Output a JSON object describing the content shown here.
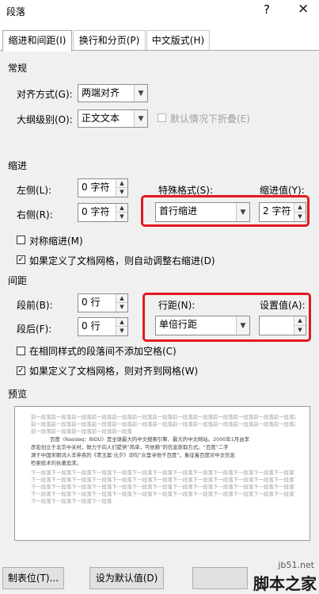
{
  "dialog": {
    "title": "段落",
    "help": "?",
    "close": "×"
  },
  "tabs": [
    {
      "label": "缩进和间距(I)"
    },
    {
      "label": "换行和分页(P)"
    },
    {
      "label": "中文版式(H)"
    }
  ],
  "general": {
    "heading": "常规",
    "alignment_label": "对齐方式(G):",
    "alignment_value": "两端对齐",
    "outline_label": "大纲级别(O):",
    "outline_value": "正文文本",
    "collapse_label": "默认情况下折叠(E)"
  },
  "indent": {
    "heading": "缩进",
    "left_label": "左侧(L):",
    "left_value": "0 字符",
    "right_label": "右侧(R):",
    "right_value": "0 字符",
    "special_label": "特殊格式(S):",
    "special_value": "首行缩进",
    "by_label": "缩进值(Y):",
    "by_value": "2 字符",
    "mirror_label": "对称缩进(M)",
    "auto_adjust_label": "如果定义了文档网格，则自动调整右缩进(D)"
  },
  "spacing": {
    "heading": "间距",
    "before_label": "段前(B):",
    "before_value": "0 行",
    "after_label": "段后(F):",
    "after_value": "0 行",
    "line_label": "行距(N):",
    "line_value": "单倍行距",
    "at_label": "设置值(A):",
    "at_value": "",
    "no_space_label": "在相同样式的段落间不添加空格(C)",
    "snap_grid_label": "如果定义了文档网格，则对齐到网格(W)"
  },
  "preview": {
    "heading": "预览",
    "prev_line": "前一段落前一段落前一段落前一段落前一段落前一段落前一段落前一段落前一段落前一段落前一段落前一段落前一段落前一段落",
    "prev_line_short": "前一段落前一段落前一段落前一段落前一段落",
    "body_lines": [
      "百度（Nasdaq：BIDU）是全球最大的中文搜索引擎、最大的中文网站。2000年1月由李",
      "彦宏创立于北京中关村，致力于向人们提供“简单，可依赖”的信息获取方式。“百度”二字",
      "源于中国宋朝词人辛弃疾的《青玉案·元夕》词句“众里寻他千百度”，象征着百度对中文信息",
      "检索技术的执著追求。"
    ],
    "next_line": "下一段落下一段落下一段落下一段落下一段落下一段落下一段落下一段落下一段落下一段落下一段落下一段落下一段落下一段落",
    "next_line_short": "下一段落下一段落下一段落下一段落"
  },
  "buttons": {
    "tabs_label": "制表位(T)...",
    "default_label": "设为默认值(D)"
  },
  "watermark": {
    "site": "jb51.net",
    "brand": "脚本之家"
  }
}
